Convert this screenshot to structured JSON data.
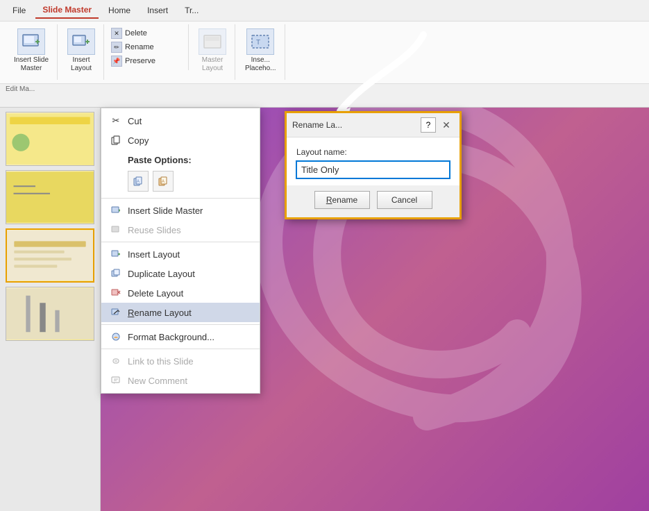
{
  "background": {
    "color1": "#7b3fa0",
    "color2": "#c06090"
  },
  "ribbon": {
    "tabs": [
      {
        "label": "File",
        "active": false
      },
      {
        "label": "Slide Master",
        "active": true
      },
      {
        "label": "Home",
        "active": false
      },
      {
        "label": "Insert",
        "active": false
      },
      {
        "label": "Tr...",
        "active": false
      }
    ],
    "groups": {
      "edit_master_label": "Edit Ma...",
      "insert_slide_master_label": "Insert Slide\nMaster",
      "insert_layout_label": "Insert\nLayout",
      "delete_label": "Delete",
      "rename_label": "Rename",
      "preserve_label": "Preserve",
      "master_label": "Master\nLayout",
      "insert_placeholder_label": "Inse...\nPlaceho..."
    }
  },
  "context_menu": {
    "items": [
      {
        "id": "cut",
        "icon": "✂",
        "label": "Cut",
        "disabled": false
      },
      {
        "id": "copy",
        "icon": "📋",
        "label": "Copy",
        "disabled": false
      },
      {
        "id": "paste-options-label",
        "icon": "",
        "label": "Paste Options:",
        "bold": true,
        "disabled": false
      },
      {
        "id": "insert-slide-master",
        "icon": "⊞",
        "label": "Insert Slide Master",
        "disabled": false
      },
      {
        "id": "reuse-slides",
        "icon": "⊡",
        "label": "Reuse Slides",
        "disabled": true
      },
      {
        "id": "insert-layout",
        "icon": "⊞",
        "label": "Insert Layout",
        "disabled": false
      },
      {
        "id": "duplicate-layout",
        "icon": "⧉",
        "label": "Duplicate Layout",
        "disabled": false
      },
      {
        "id": "delete-layout",
        "icon": "✕",
        "label": "Delete Layout",
        "disabled": false
      },
      {
        "id": "rename-layout",
        "icon": "✏",
        "label": "Rename Layout",
        "highlighted": true,
        "disabled": false
      },
      {
        "id": "format-background",
        "icon": "🎨",
        "label": "Format Background...",
        "disabled": false
      },
      {
        "id": "link-to-slide",
        "icon": "🔗",
        "label": "Link to this Slide",
        "disabled": true
      },
      {
        "id": "new-comment",
        "icon": "💬",
        "label": "New Comment",
        "disabled": true
      }
    ]
  },
  "dialog": {
    "title": "Rename La...",
    "help_label": "?",
    "close_label": "✕",
    "field_label": "Layout name:",
    "input_value": "Title Only",
    "rename_button": "Rename",
    "cancel_button": "Cancel"
  },
  "slides": [
    {
      "id": 1,
      "selected": false
    },
    {
      "id": 2,
      "selected": false
    },
    {
      "id": 3,
      "selected": true
    },
    {
      "id": 4,
      "selected": false
    }
  ]
}
